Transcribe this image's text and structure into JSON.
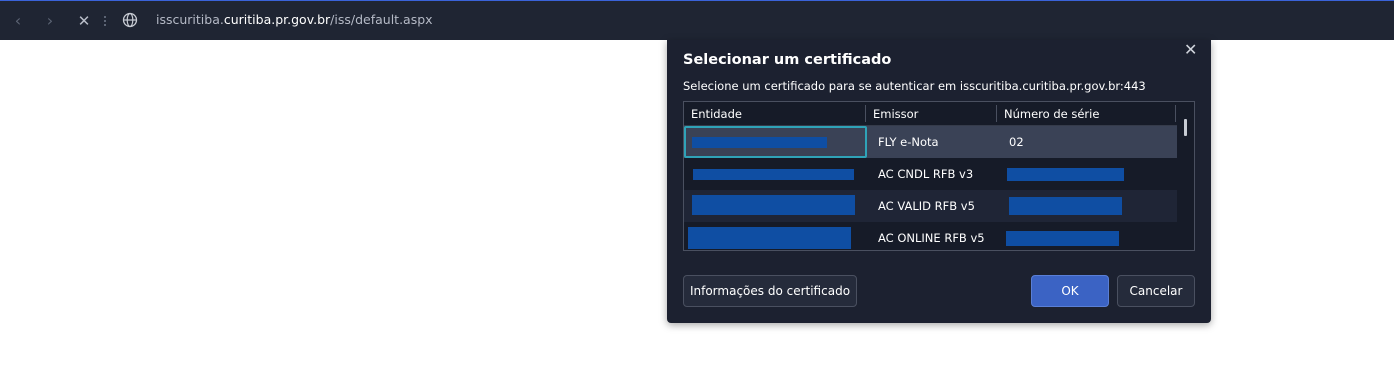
{
  "browser": {
    "nav_back": "‹",
    "nav_forward": "›",
    "nav_stop": "✕",
    "url_prefix": "isscuritiba.",
    "url_domain": "curitiba.pr.gov.br",
    "url_path": "/iss/default.aspx"
  },
  "dialog": {
    "title": "Selecionar um certificado",
    "close": "✕",
    "subtitle": "Selecione um certificado para se autenticar em isscuritiba.curitiba.pr.gov.br:443",
    "columns": [
      "Entidade",
      "Emissor",
      "Número de série"
    ],
    "rows": [
      {
        "entidade": "",
        "emissor": "FLY e-Nota",
        "serie": "02",
        "selected": true
      },
      {
        "entidade": "",
        "emissor": "AC CNDL RFB v3",
        "serie": ""
      },
      {
        "entidade": "",
        "emissor": "AC VALID RFB v5",
        "serie": ""
      },
      {
        "entidade": "",
        "emissor": "AC ONLINE RFB v5",
        "serie": ""
      }
    ],
    "buttons": {
      "info": "Informações do certificado",
      "ok": "OK",
      "cancel": "Cancelar"
    }
  },
  "colors": {
    "accent": "#3b63c4",
    "redaction": "#0f4ea3",
    "focus": "#2fa3b8"
  }
}
